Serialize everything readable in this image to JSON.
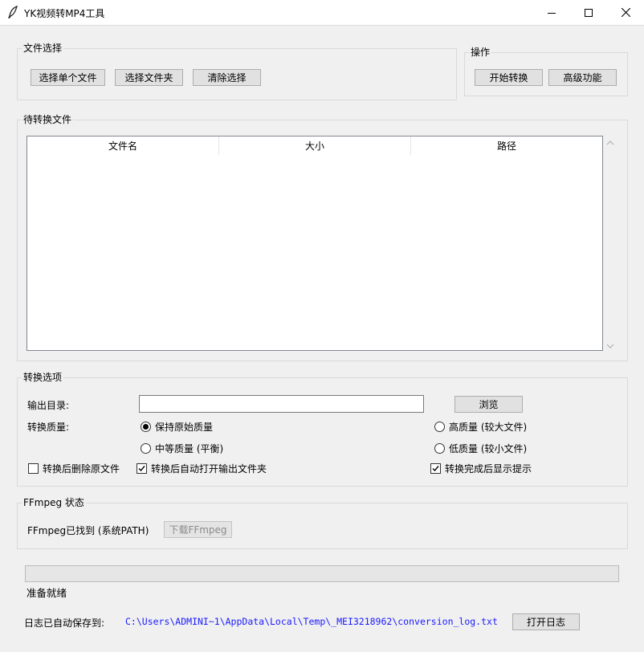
{
  "window": {
    "title": "YK视频转MP4工具"
  },
  "file_select": {
    "title": "文件选择",
    "select_file": "选择单个文件",
    "select_folder": "选择文件夹",
    "clear": "清除选择"
  },
  "actions": {
    "title": "操作",
    "start": "开始转换",
    "advanced": "高级功能"
  },
  "pending": {
    "title": "待转换文件",
    "columns": [
      "文件名",
      "大小",
      "路径"
    ],
    "rows": []
  },
  "options": {
    "title": "转换选项",
    "output_dir_label": "输出目录:",
    "output_dir_value": "",
    "browse": "浏览",
    "quality_label": "转换质量:",
    "quality_original": "保持原始质量",
    "quality_high": "高质量 (较大文件)",
    "quality_medium": "中等质量 (平衡)",
    "quality_low": "低质量 (较小文件)",
    "selected_quality": "original",
    "delete_source": {
      "label": "转换后删除原文件",
      "checked": false
    },
    "open_output": {
      "label": "转换后自动打开输出文件夹",
      "checked": true
    },
    "show_tip": {
      "label": "转换完成后显示提示",
      "checked": true
    }
  },
  "ffmpeg": {
    "title": "FFmpeg 状态",
    "status": "FFmpeg已找到 (系统PATH)",
    "download": "下载FFmpeg"
  },
  "progress": {
    "value": 0,
    "status": "准备就绪"
  },
  "log": {
    "label": "日志已自动保存到:",
    "path": "C:\\Users\\ADMINI~1\\AppData\\Local\\Temp\\_MEI3218962\\conversion_log.txt",
    "open": "打开日志"
  },
  "colors": {
    "link": "#1a1aff",
    "progress": "#06b025"
  }
}
